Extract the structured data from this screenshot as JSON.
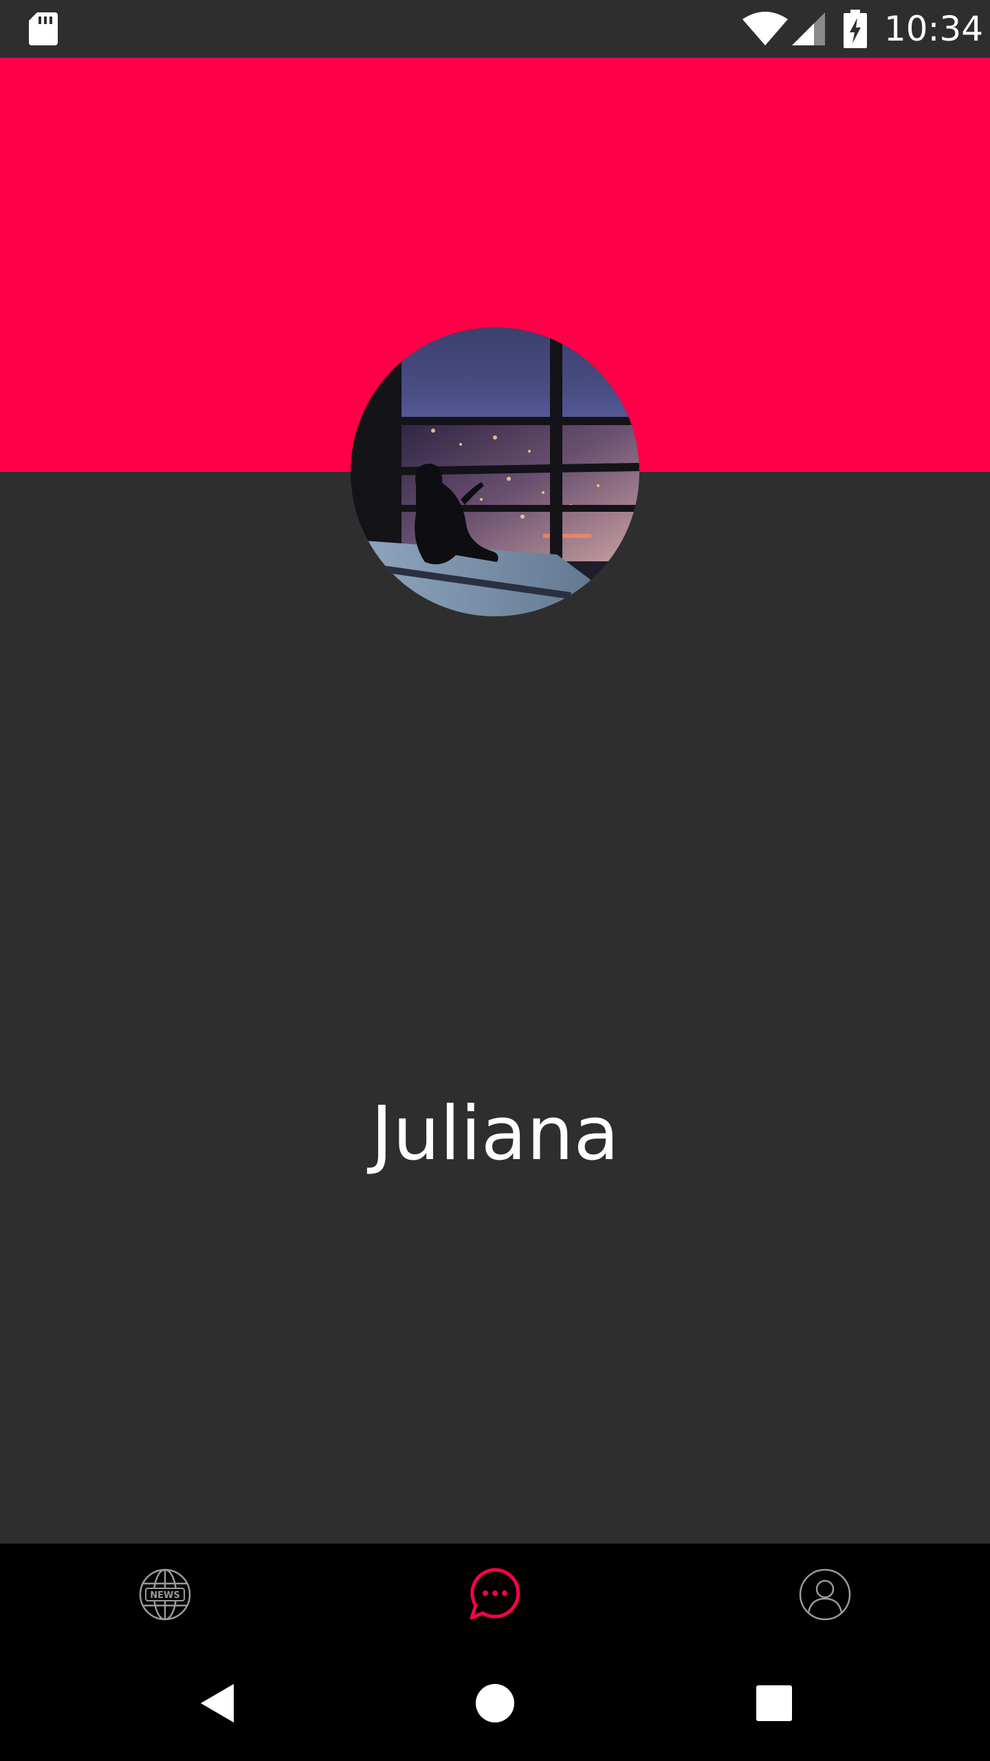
{
  "status_bar": {
    "time": "10:34",
    "icons": [
      "sd-card-icon",
      "wifi-icon",
      "cell-signal-icon",
      "battery-charging-icon"
    ]
  },
  "profile": {
    "name": "Juliana",
    "avatar_description": "photo-avatar"
  },
  "bottom_nav": {
    "tabs": [
      {
        "icon": "news-globe-icon",
        "active": false,
        "badge_text": "NEWS"
      },
      {
        "icon": "chat-bubble-icon",
        "active": true
      },
      {
        "icon": "user-profile-icon",
        "active": false
      }
    ]
  },
  "system_nav": {
    "buttons": [
      "back-icon",
      "home-icon",
      "recents-icon"
    ]
  },
  "colors": {
    "accent": "#ff0048",
    "background": "#2e2e2e",
    "nav_background": "#000000",
    "inactive_icon": "#9a9a9a",
    "text": "#ffffff"
  }
}
